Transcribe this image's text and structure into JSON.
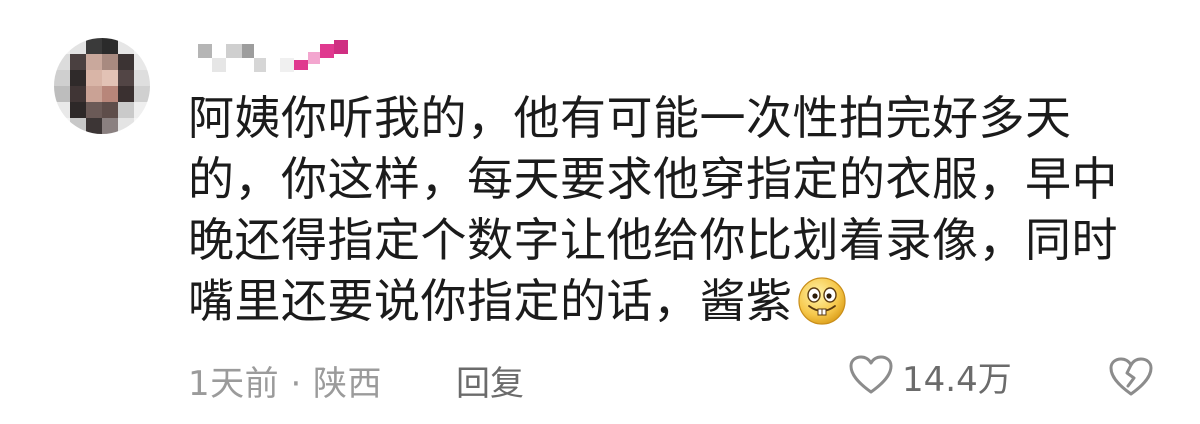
{
  "comment": {
    "text_lines": [
      "阿姨你听我的，他有可能一次性拍完好多天",
      "的，你这样，每天要求他穿指定的衣服，早中",
      "晚还得指定个数字让他给你比划着录像，同时",
      "嘴里还要说你指定的话，酱紫"
    ],
    "emoji": "grinning-buck-tooth-emoji",
    "time_location": "1天前 · 陕西",
    "reply_label": "回复",
    "like_count": "14.4万",
    "icons": {
      "like": "heart-outline-icon",
      "dislike": "broken-heart-outline-icon"
    },
    "colors": {
      "text": "#1b1b1b",
      "meta": "#9b9b9b",
      "action": "#6b6b6b",
      "username_accent": "#e0398f"
    }
  }
}
